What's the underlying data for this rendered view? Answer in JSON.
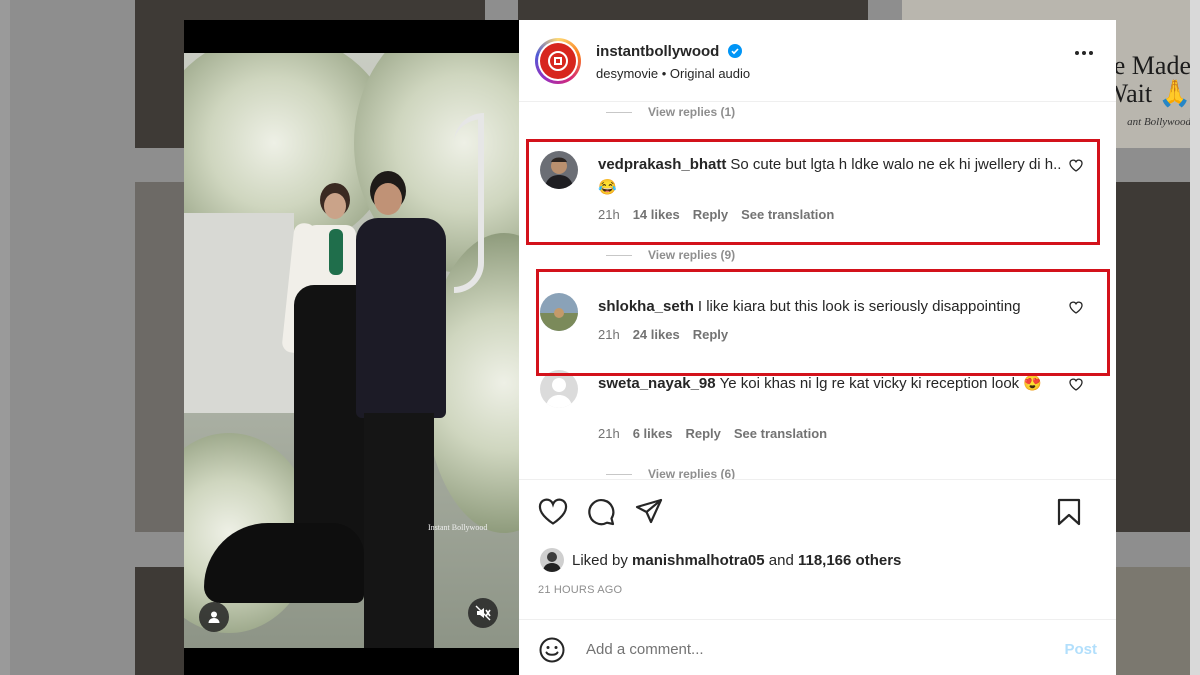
{
  "post": {
    "username": "instantbollywood",
    "verified": true,
    "audio_line": "desymovie • Original audio",
    "watermark": "Instant Bollywood"
  },
  "background": {
    "caption_line1": "e Made",
    "caption_line2": "Wait 🙏",
    "caption_small": "ant Bollywood"
  },
  "comments": [
    {
      "type": "view-replies",
      "label": "View replies (1)"
    },
    {
      "type": "comment",
      "username": "vedprakash_bhatt",
      "text": "So cute but lgta h ldke walo ne ek hi jwellery di h..😂",
      "time": "21h",
      "likes": "14 likes",
      "reply": "Reply",
      "translate": "See translation",
      "highlighted": true
    },
    {
      "type": "view-replies",
      "label": "View replies (9)"
    },
    {
      "type": "comment",
      "username": "shlokha_seth",
      "text": "I like kiara but this look is seriously disappointing",
      "time": "21h",
      "likes": "24 likes",
      "reply": "Reply",
      "highlighted": true
    },
    {
      "type": "comment",
      "username": "sweta_nayak_98",
      "text": "Ye koi khas ni lg re kat vicky ki reception look 😍",
      "time": "21h",
      "likes": "6 likes",
      "reply": "Reply",
      "translate": "See translation",
      "highlighted": false
    },
    {
      "type": "view-replies",
      "label": "View replies (6)"
    }
  ],
  "likes": {
    "prefix": "Liked by",
    "user": "manishmalhotra05",
    "middle": "and",
    "others": "118,166 others"
  },
  "posted": "21 HOURS AGO",
  "add_comment": {
    "placeholder": "Add a comment...",
    "post_label": "Post"
  },
  "icons": {
    "like": "heart-icon",
    "comment": "comment-icon",
    "share": "send-icon",
    "save": "bookmark-icon",
    "more": "more-icon",
    "emoji": "emoji-icon",
    "mute": "muted-speaker-icon",
    "tags": "user-tag-icon"
  },
  "colors": {
    "highlight": "#d3121b",
    "verified": "#0095f6",
    "post_disabled": "#b2dffc"
  }
}
